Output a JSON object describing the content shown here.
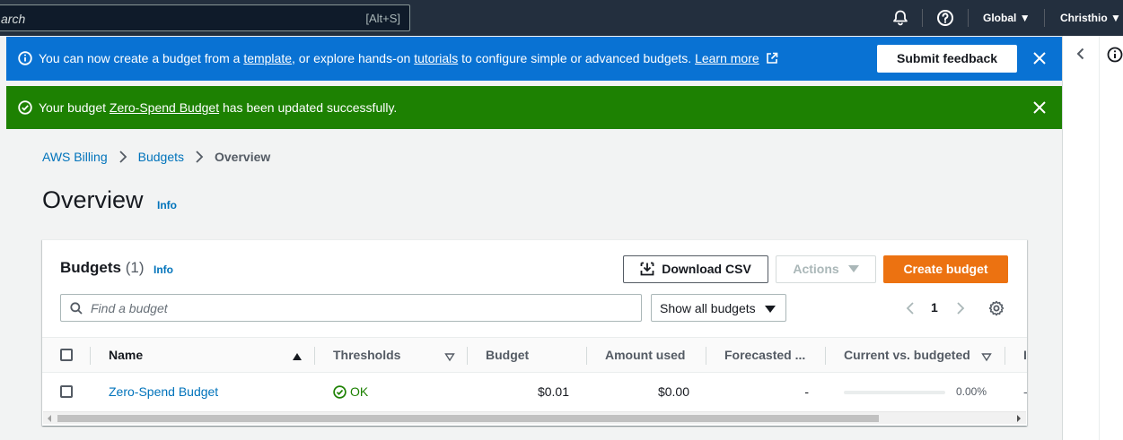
{
  "topnav": {
    "search_placeholder": "arch",
    "search_shortcut": "[Alt+S]",
    "region": "Global",
    "user": "Christhio"
  },
  "flash_info": {
    "text_1": "You can now create a budget from a ",
    "link_template": "template",
    "text_2": ", or explore hands-on ",
    "link_tutorials": "tutorials",
    "text_3": " to configure simple or advanced budgets. ",
    "link_learn_more": "Learn more",
    "feedback_button": "Submit feedback"
  },
  "flash_success": {
    "text_1": "Your budget ",
    "link_budget": "Zero-Spend Budget",
    "text_2": " has been updated successfully."
  },
  "breadcrumb": [
    "AWS Billing",
    "Budgets",
    "Overview"
  ],
  "page": {
    "title": "Overview",
    "info": "Info"
  },
  "budgets": {
    "title": "Budgets",
    "count": "(1)",
    "info": "Info",
    "download_csv": "Download CSV",
    "actions": "Actions",
    "create_budget": "Create budget",
    "find_placeholder": "Find a budget",
    "filter_value": "Show all budgets",
    "page_number": "1"
  },
  "table": {
    "columns": [
      "Name",
      "Thresholds",
      "Budget",
      "Amount used",
      "Forecasted ...",
      "Current vs. budgeted"
    ],
    "rows": [
      {
        "name": "Zero-Spend Budget",
        "thresholds": "OK",
        "budget": "$0.01",
        "amount_used": "$0.00",
        "forecasted": "-",
        "current_vs_budgeted": "0.00%",
        "current_vs_budgeted_fraction": 0.0,
        "overflow": "-"
      }
    ]
  },
  "colors": {
    "nav_bg": "#232f3e",
    "info_flash": "#0972d3",
    "success_flash": "#1d8102",
    "primary_button": "#ec7211",
    "link": "#0073bb"
  }
}
